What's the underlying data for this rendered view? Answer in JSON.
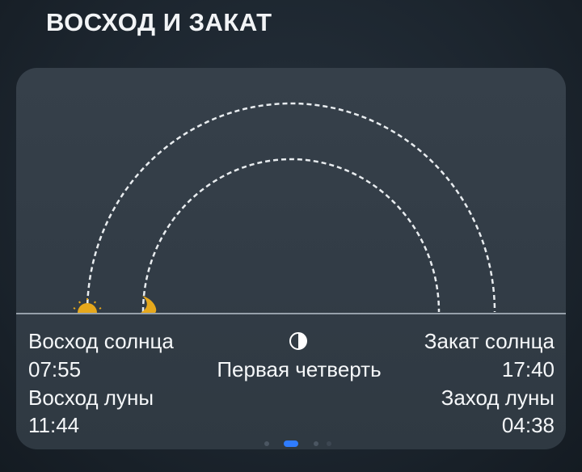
{
  "section": {
    "title": "ВОСХОД И ЗАКАТ"
  },
  "sun": {
    "rise_label": "Восход солнца",
    "rise_time": "07:55",
    "set_label": "Закат солнца",
    "set_time": "17:40"
  },
  "moon": {
    "rise_label": "Восход луны",
    "rise_time": "11:44",
    "set_label": "Заход луны",
    "set_time": "04:38",
    "phase_label": "Первая четверть"
  },
  "icons": {
    "sun": "sun-icon",
    "moon": "crescent-moon-icon",
    "phase": "half-moon-phase-icon"
  },
  "colors": {
    "accent": "#2f7cff",
    "sun_moon_icon": "#e6a81c",
    "arc": "#e8ecef",
    "horizon": "#b8c2cc"
  },
  "pager": {
    "pages": 4,
    "active": 1
  }
}
